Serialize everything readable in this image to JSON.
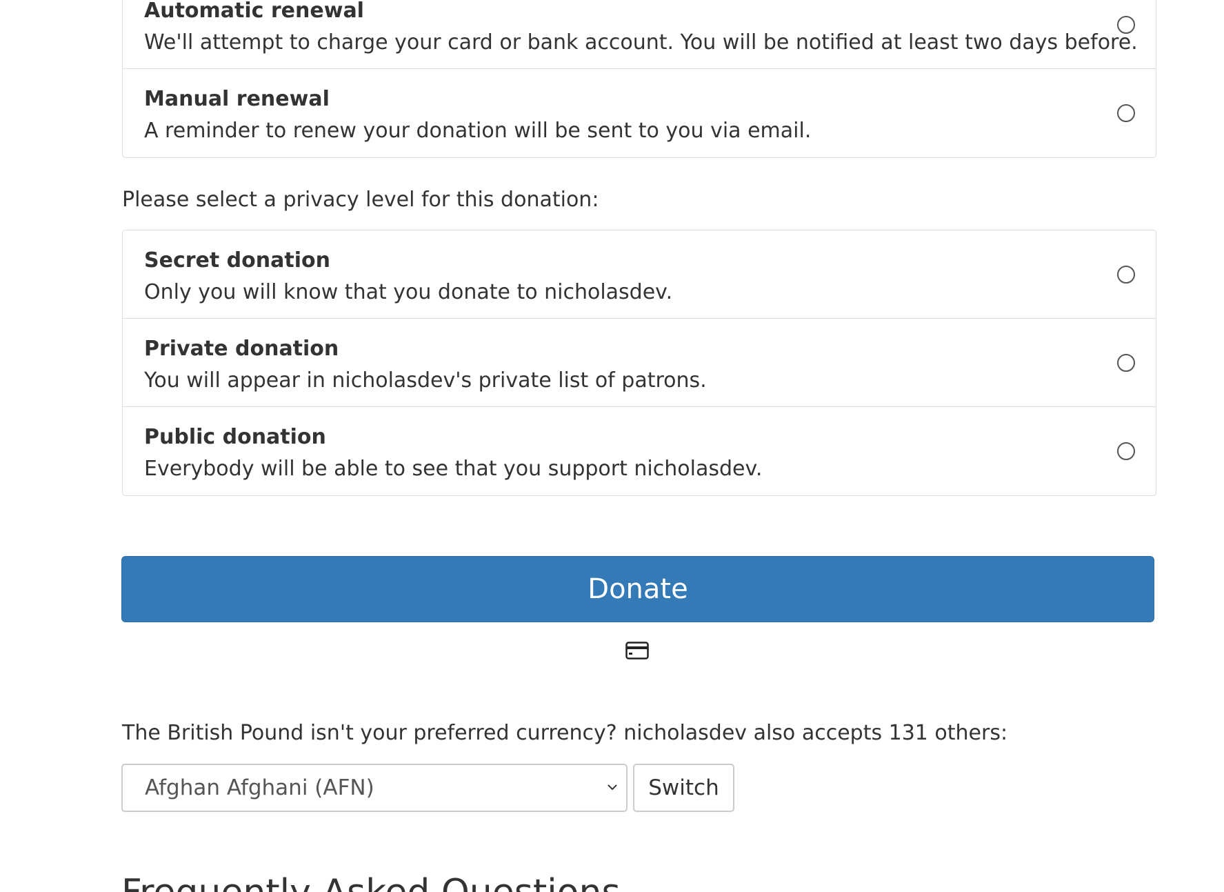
{
  "renewal": {
    "options": [
      {
        "title": "Automatic renewal",
        "description": "We'll attempt to charge your card or bank account. You will be notified at least two days before."
      },
      {
        "title": "Manual renewal",
        "description": "A reminder to renew your donation will be sent to you via email."
      }
    ]
  },
  "privacy": {
    "prompt": "Please select a privacy level for this donation:",
    "options": [
      {
        "title": "Secret donation",
        "description": "Only you will know that you donate to nicholasdev."
      },
      {
        "title": "Private donation",
        "description": "You will appear in nicholasdev's private list of patrons."
      },
      {
        "title": "Public donation",
        "description": "Everybody will be able to see that you support nicholasdev."
      }
    ]
  },
  "donate_button": {
    "label": "Donate",
    "color": "#337ab7"
  },
  "payment_icon": "credit-card-icon",
  "currency": {
    "prompt": "The British Pound isn't your preferred currency? nicholasdev also accepts 131 others:",
    "selected": "Afghan Afghani (AFN)",
    "switch_label": "Switch"
  },
  "faq": {
    "heading": "Frequently Asked Questions"
  }
}
